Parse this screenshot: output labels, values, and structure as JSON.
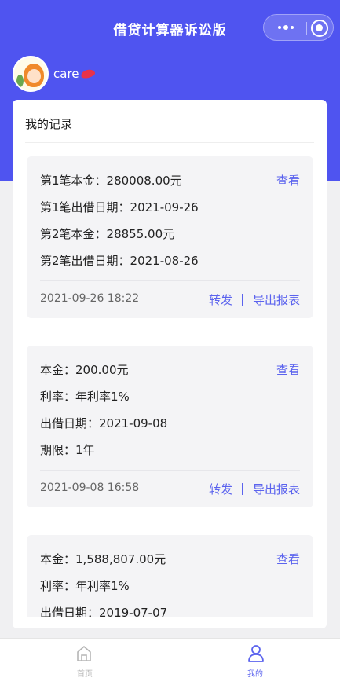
{
  "app": {
    "title": "借贷计算器诉讼版"
  },
  "user": {
    "name": "care"
  },
  "records_section": {
    "title": "我的记录",
    "view_label": "查看",
    "share_label": "转发",
    "export_label": "导出报表"
  },
  "records": [
    {
      "lines": [
        "第1笔本金：280008.00元",
        "第1笔出借日期：2021-09-26",
        "第2笔本金：28855.00元",
        "第2笔出借日期：2021-08-26"
      ],
      "time": "2021-09-26 18:22"
    },
    {
      "lines": [
        "本金：200.00元",
        "利率：年利率1%",
        "出借日期：2021-09-08",
        "期限：1年"
      ],
      "time": "2021-09-08 16:58"
    },
    {
      "lines": [
        "本金：1,588,807.00元",
        "利率：年利率1%",
        "出借日期：2019-07-07"
      ]
    }
  ],
  "tabbar": {
    "home_label": "首页",
    "mine_label": "我的"
  },
  "colors": {
    "brand": "#4f54f0",
    "accent": "#5b63ee"
  }
}
